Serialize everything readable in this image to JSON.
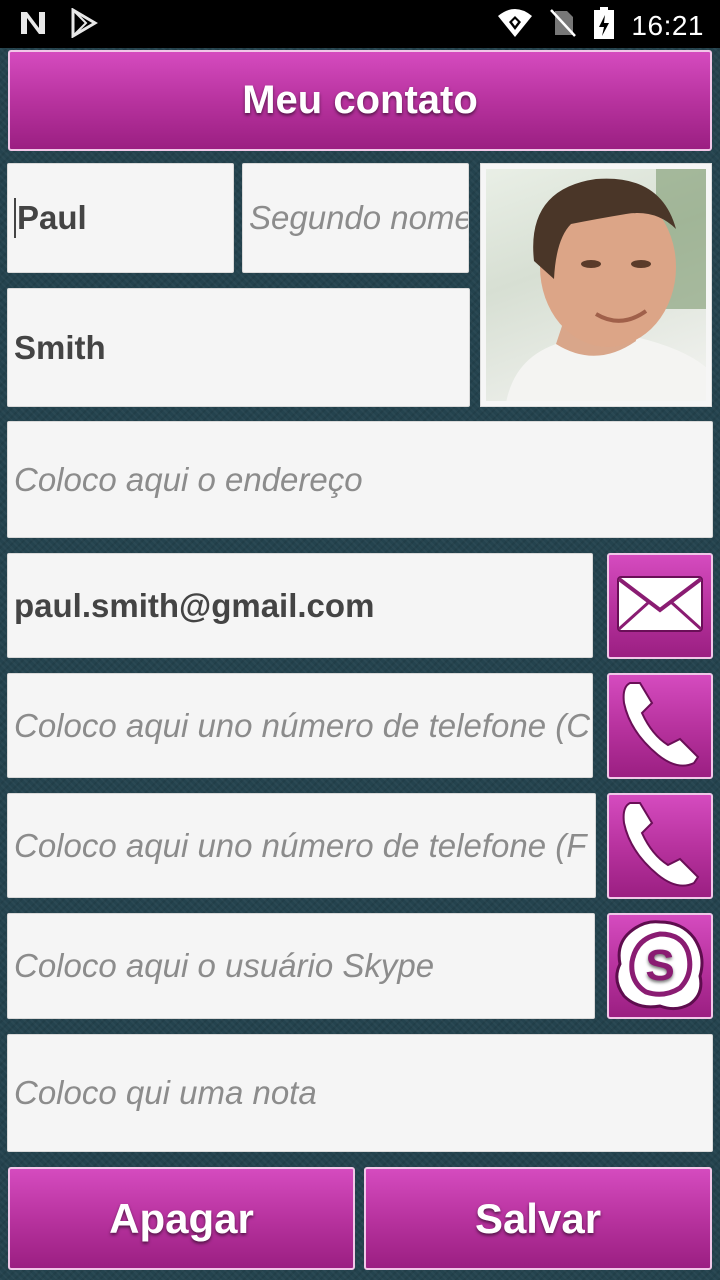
{
  "status_bar": {
    "time": "16:21",
    "icons": [
      "n-notification-icon",
      "play-store-icon",
      "wifi-icon",
      "no-sim-icon",
      "battery-charging-icon"
    ]
  },
  "header": {
    "title": "Meu contato"
  },
  "form": {
    "first_name": {
      "value": "Paul",
      "placeholder": ""
    },
    "middle_name": {
      "value": "",
      "placeholder": "Segundo nome"
    },
    "last_name": {
      "value": "Smith",
      "placeholder": ""
    },
    "address": {
      "value": "",
      "placeholder": "Coloco aqui o endereço"
    },
    "email": {
      "value": "paul.smith@gmail.com",
      "placeholder": ""
    },
    "phone1": {
      "value": "",
      "placeholder": "Coloco aqui uno número de telefone (C"
    },
    "phone2": {
      "value": "",
      "placeholder": "Coloco aqui uno número de telefone (F"
    },
    "skype": {
      "value": "",
      "placeholder": "Coloco aqui o usuário Skype"
    },
    "note": {
      "value": "",
      "placeholder": "Coloco qui uma nota"
    }
  },
  "photo": {
    "alt": "contact-photo"
  },
  "actions": {
    "email_icon": "envelope-icon",
    "phone1_icon": "phone-icon",
    "phone2_icon": "phone-icon",
    "skype_icon": "skype-icon"
  },
  "footer": {
    "delete_label": "Apagar",
    "save_label": "Salvar"
  },
  "colors": {
    "accent": "#b8339f",
    "field_bg": "#f5f5f5",
    "background": "#24434e"
  }
}
